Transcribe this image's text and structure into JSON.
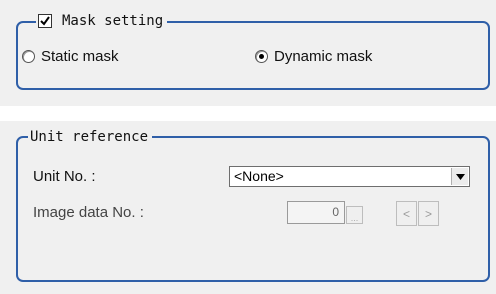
{
  "mask_setting": {
    "title": "Mask setting",
    "enabled": true,
    "options": [
      {
        "label": "Static mask",
        "selected": false
      },
      {
        "label": "Dynamic mask",
        "selected": true
      }
    ]
  },
  "unit_reference": {
    "title": "Unit reference",
    "unit_no_label": "Unit No. :",
    "unit_no_value": "<None>",
    "image_data_label": "Image data No. :",
    "image_data_value": "0",
    "ellipsis_label": "...",
    "prev_label": "<",
    "next_label": ">"
  },
  "colors": {
    "groupbox_border": "#2f5fa8",
    "panel_bg": "#f0f0f0"
  }
}
